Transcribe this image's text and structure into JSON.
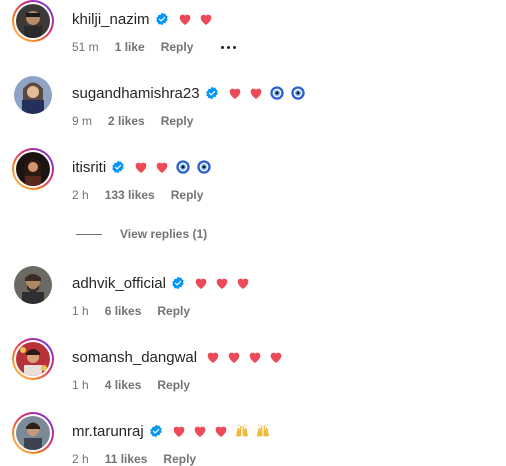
{
  "colors": {
    "heart": "#ed4956",
    "verified": "#0095f6",
    "muted": "#737373",
    "text": "#262626"
  },
  "comments": [
    {
      "username": "khilji_nazim",
      "verified": true,
      "story_ring": true,
      "emojis": [
        "heart",
        "heart"
      ],
      "time": "51 m",
      "likes": "1 like",
      "reply": "Reply",
      "has_more": true
    },
    {
      "username": "sugandhamishra23",
      "verified": true,
      "story_ring": false,
      "emojis": [
        "heart",
        "heart",
        "nazar",
        "nazar"
      ],
      "time": "9 m",
      "likes": "2 likes",
      "reply": "Reply",
      "has_more": false
    },
    {
      "username": "itisriti",
      "verified": true,
      "story_ring": true,
      "emojis": [
        "heart",
        "heart",
        "nazar",
        "nazar"
      ],
      "time": "2 h",
      "likes": "133 likes",
      "reply": "Reply",
      "has_more": false
    },
    {
      "username": "adhvik_official",
      "verified": true,
      "story_ring": false,
      "emojis": [
        "heart",
        "heart",
        "heart"
      ],
      "time": "1 h",
      "likes": "6 likes",
      "reply": "Reply",
      "has_more": false
    },
    {
      "username": "somansh_dangwal",
      "verified": false,
      "story_ring": true,
      "emojis": [
        "heart",
        "heart",
        "heart",
        "heart"
      ],
      "time": "1 h",
      "likes": "4 likes",
      "reply": "Reply",
      "has_more": false
    },
    {
      "username": "mr.tarunraj",
      "verified": true,
      "story_ring": true,
      "emojis": [
        "heart",
        "heart",
        "heart",
        "raised_hands",
        "raised_hands"
      ],
      "time": "2 h",
      "likes": "11 likes",
      "reply": "Reply",
      "has_more": false
    }
  ],
  "view_replies": "View replies (1)"
}
